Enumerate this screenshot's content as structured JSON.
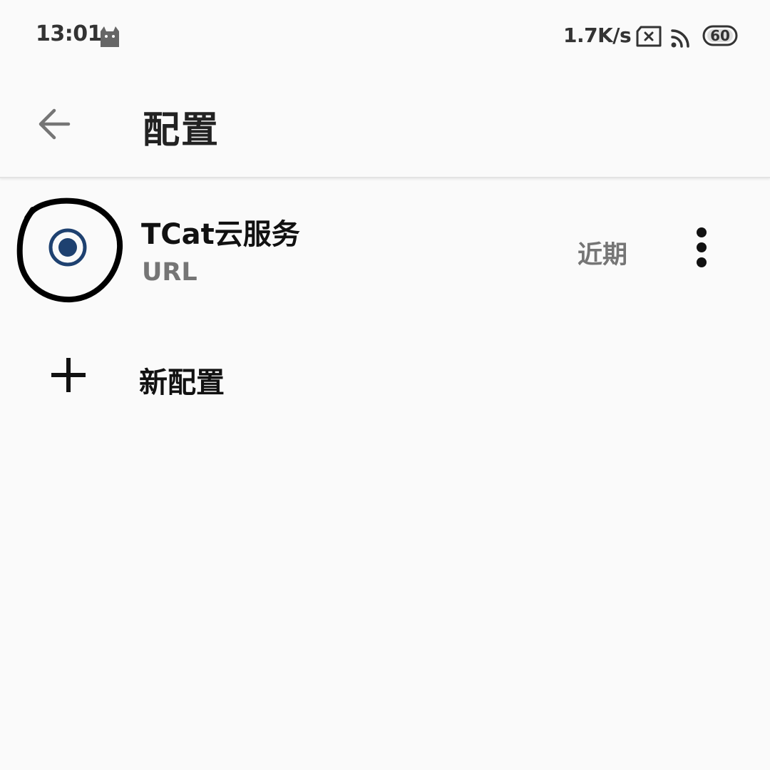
{
  "status_bar": {
    "time": "13:01",
    "network_speed": "1.7K/s",
    "battery_level": "60",
    "icons": [
      "cat-icon",
      "sim-x-icon",
      "wifi-icon",
      "battery-icon"
    ]
  },
  "toolbar": {
    "back_icon": "arrow-left-icon",
    "title": "配置"
  },
  "profiles": [
    {
      "name": "TCat云服务",
      "type": "URL",
      "updated": "近期",
      "selected": true,
      "more_icon": "more-vert-icon"
    }
  ],
  "new_profile": {
    "icon": "plus-icon",
    "label": "新配置"
  },
  "colors": {
    "background": "#fafafa",
    "radio_accent": "#1e4170",
    "primary_text": "#111111",
    "secondary_text": "#757575",
    "status_text": "#333333",
    "annotation": "#000000"
  }
}
